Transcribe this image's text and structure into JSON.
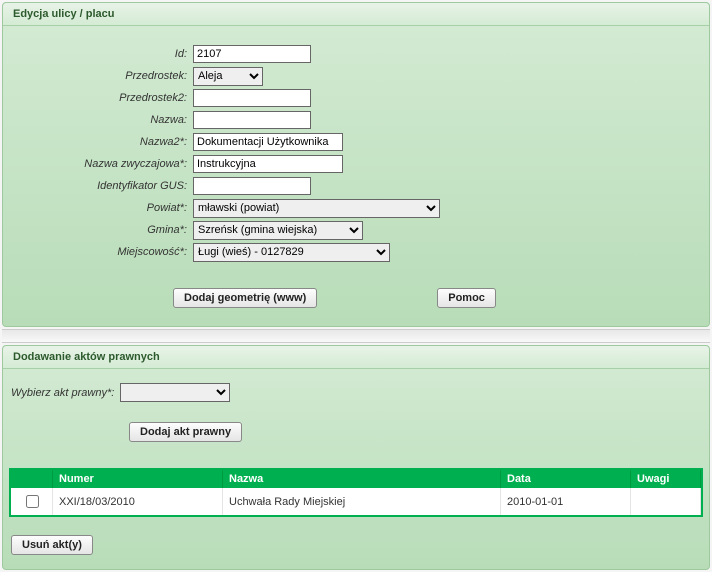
{
  "panel1": {
    "title": "Edycja ulicy / placu",
    "fields": {
      "id_label": "Id:",
      "id_value": "2107",
      "przedrostek_label": "Przedrostek:",
      "przedrostek_value": "Aleja",
      "przedrostek2_label": "Przedrostek2:",
      "przedrostek2_value": "",
      "nazwa_label": "Nazwa:",
      "nazwa_value": "",
      "nazwa2_label": "Nazwa2*:",
      "nazwa2_value": "Dokumentacji Użytkownika",
      "nazwa_zw_label": "Nazwa zwyczajowa*:",
      "nazwa_zw_value": "Instrukcyjna",
      "ident_gus_label": "Identyfikator GUS:",
      "ident_gus_value": "",
      "powiat_label": "Powiat*:",
      "powiat_value": "mławski (powiat)",
      "gmina_label": "Gmina*:",
      "gmina_value": "Szreńsk (gmina wiejska)",
      "miejscowosc_label": "Miejscowość*:",
      "miejscowosc_value": "Ługi (wieś) - 0127829"
    },
    "buttons": {
      "geom": "Dodaj geometrię (www)",
      "help": "Pomoc"
    }
  },
  "panel2": {
    "title": "Dodawanie aktów prawnych",
    "wybierz_label": "Wybierz akt prawny*:",
    "wybierz_value": "",
    "add_btn": "Dodaj akt prawny",
    "table": {
      "col_check": "",
      "col_numer": "Numer",
      "col_nazwa": "Nazwa",
      "col_data": "Data",
      "col_uwagi": "Uwagi",
      "rows": [
        {
          "numer": "XXI/18/03/2010",
          "nazwa": "Uchwała Rady Miejskiej",
          "data": "2010-01-01",
          "uwagi": ""
        }
      ]
    },
    "del_btn": "Usuń akt(y)"
  }
}
